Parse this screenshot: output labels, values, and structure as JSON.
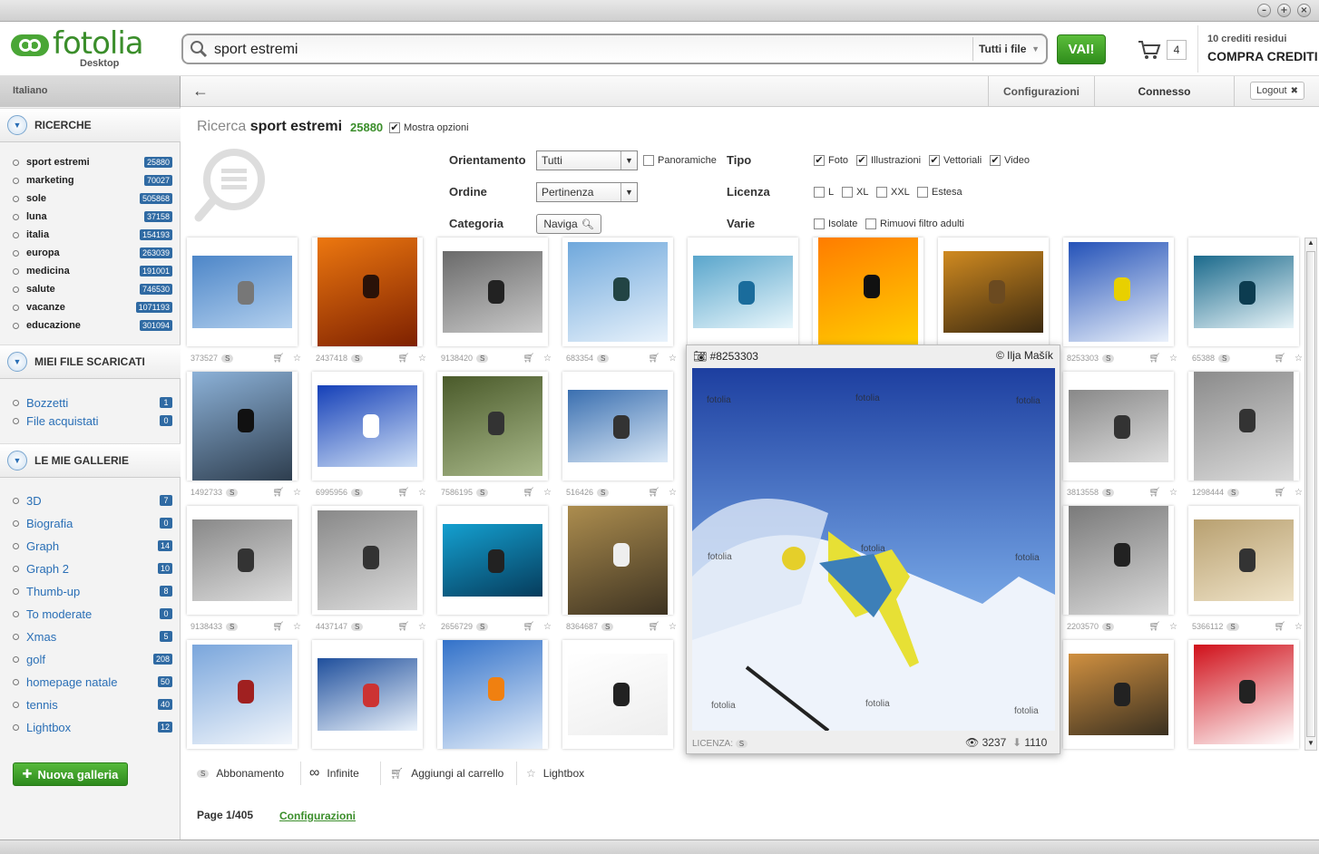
{
  "window": {
    "minimize": "–",
    "maximize": "+",
    "close": "×"
  },
  "brand": {
    "logo": "fotolia",
    "sub": "Desktop",
    "color": "#3b8e2b"
  },
  "search": {
    "query": "sport estremi",
    "file_filter": "Tutti i file",
    "go": "VAI!"
  },
  "cart": {
    "count": "4"
  },
  "credits": {
    "left": "10 crediti residui",
    "buy": "COMPRA CREDITI"
  },
  "nav": {
    "language": "Italiano",
    "config": "Configurazioni",
    "connected": "Connesso",
    "logout": "Logout"
  },
  "sidebar": {
    "searches_title": "RICERCHE",
    "searches": [
      {
        "label": "sport estremi",
        "count": "25880"
      },
      {
        "label": "marketing",
        "count": "70027"
      },
      {
        "label": "sole",
        "count": "505868"
      },
      {
        "label": "luna",
        "count": "37158"
      },
      {
        "label": "italia",
        "count": "154193"
      },
      {
        "label": "europa",
        "count": "263039"
      },
      {
        "label": "medicina",
        "count": "191001"
      },
      {
        "label": "salute",
        "count": "746530"
      },
      {
        "label": "vacanze",
        "count": "1071193"
      },
      {
        "label": "educazione",
        "count": "301094"
      }
    ],
    "downloads_title": "MIEI FILE SCARICATI",
    "downloads": [
      {
        "label": "Bozzetti",
        "count": "1"
      },
      {
        "label": "File acquistati",
        "count": "0"
      }
    ],
    "galleries_title": "LE MIE GALLERIE",
    "galleries": [
      {
        "label": "3D",
        "count": "7"
      },
      {
        "label": "Biografia",
        "count": "0"
      },
      {
        "label": "Graph",
        "count": "14"
      },
      {
        "label": "Graph 2",
        "count": "10"
      },
      {
        "label": "Thumb-up",
        "count": "8"
      },
      {
        "label": "To moderate",
        "count": "0"
      },
      {
        "label": "Xmas",
        "count": "5"
      },
      {
        "label": "golf",
        "count": "208"
      },
      {
        "label": "homepage natale",
        "count": "50"
      },
      {
        "label": "tennis",
        "count": "40"
      },
      {
        "label": "Lightbox",
        "count": "12"
      }
    ],
    "new_gallery": "Nuova galleria"
  },
  "results": {
    "prefix": "Ricerca",
    "query": "sport estremi",
    "count": "25880",
    "show_options": "Mostra opzioni",
    "orientation_label": "Orientamento",
    "orientation_value": "Tutti",
    "panoramic": "Panoramiche",
    "order_label": "Ordine",
    "order_value": "Pertinenza",
    "category_label": "Categoria",
    "category_btn": "Naviga",
    "type_label": "Tipo",
    "type_foto": "Foto",
    "type_ill": "Illustrazioni",
    "type_vec": "Vettoriali",
    "type_video": "Video",
    "license_label": "Licenza",
    "lic_l": "L",
    "lic_xl": "XL",
    "lic_xxl": "XXL",
    "lic_ext": "Estesa",
    "misc_label": "Varie",
    "misc_isolated": "Isolate",
    "misc_adult": "Rimuovi filtro adulti"
  },
  "thumbs": [
    "373527",
    "2437418",
    "9138420",
    "683354",
    "",
    "",
    "",
    "8253303",
    "65388",
    "1492733",
    "6995956",
    "7586195",
    "516426",
    "3813558",
    "1298444",
    "9138433",
    "4437147",
    "2656729",
    "8364687",
    "2203570",
    "5366112",
    "",
    "",
    "",
    "",
    "",
    ""
  ],
  "preview": {
    "id": "#8253303",
    "author": "© Ilja Mašík",
    "license": "LICENZA:",
    "views": "3237",
    "downloads": "1110",
    "watermark": "fotolia"
  },
  "legend": {
    "sub": "Abbonamento",
    "infinite": "Infinite",
    "add_cart": "Aggiungi al carrello",
    "lightbox": "Lightbox"
  },
  "pager": {
    "page": "Page 1/405",
    "config": "Configurazioni"
  }
}
